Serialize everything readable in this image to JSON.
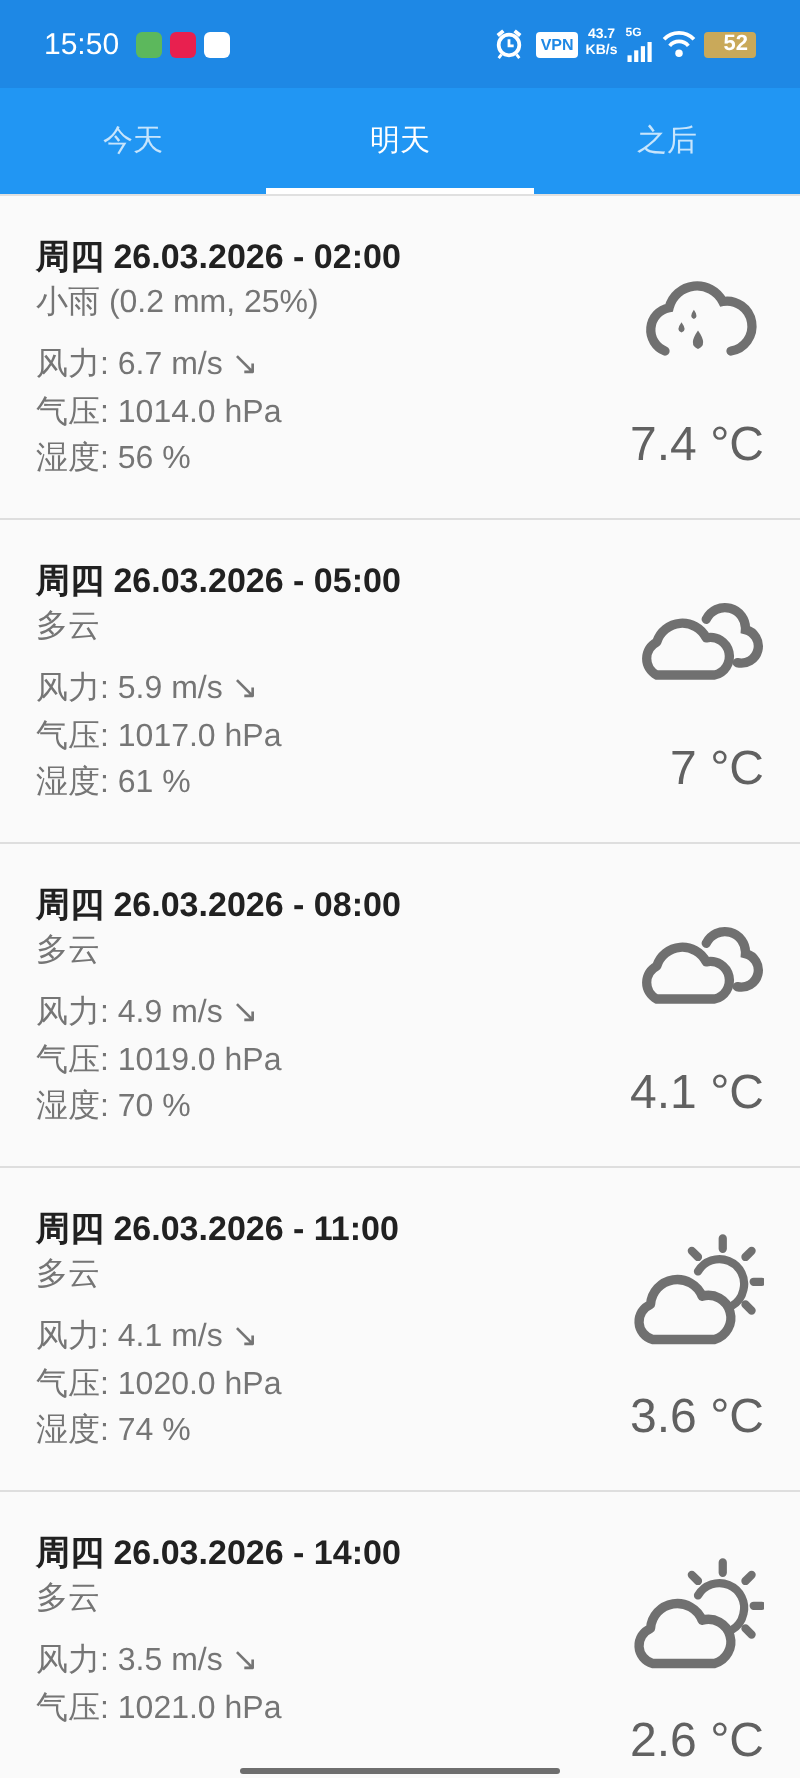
{
  "status_bar": {
    "time": "15:50",
    "apps": [
      {
        "color": "#5cb85c"
      },
      {
        "color": "#e8204f"
      },
      {
        "color": "#ffffff"
      }
    ],
    "vpn": "VPN",
    "speed_value": "43.7",
    "speed_unit": "KB/s",
    "network": "5G",
    "battery": "52"
  },
  "tabs": [
    {
      "label": "今天",
      "selected": false
    },
    {
      "label": "明天",
      "selected": true
    },
    {
      "label": "之后",
      "selected": false
    }
  ],
  "forecasts": [
    {
      "datetime": "周四 26.03.2026 - 02:00",
      "condition": "小雨 (0.2 mm, 25%)",
      "wind": "风力: 6.7 m/s ↘",
      "pressure": "气压: 1014.0 hPa",
      "humidity": "湿度: 56 %",
      "temperature": "7.4 °C",
      "kind": "rain"
    },
    {
      "datetime": "周四 26.03.2026 - 05:00",
      "condition": "多云",
      "wind": "风力: 5.9 m/s ↘",
      "pressure": "气压: 1017.0 hPa",
      "humidity": "湿度: 61 %",
      "temperature": "7 °C",
      "kind": "cloudy"
    },
    {
      "datetime": "周四 26.03.2026 - 08:00",
      "condition": "多云",
      "wind": "风力: 4.9 m/s ↘",
      "pressure": "气压: 1019.0 hPa",
      "humidity": "湿度: 70 %",
      "temperature": "4.1 °C",
      "kind": "cloudy"
    },
    {
      "datetime": "周四 26.03.2026 - 11:00",
      "condition": "多云",
      "wind": "风力: 4.1 m/s ↘",
      "pressure": "气压: 1020.0 hPa",
      "humidity": "湿度: 74 %",
      "temperature": "3.6 °C",
      "kind": "partly"
    },
    {
      "datetime": "周四 26.03.2026 - 14:00",
      "condition": "多云",
      "wind": "风力: 3.5 m/s ↘",
      "pressure": "气压: 1021.0 hPa",
      "temperature": "2.6 °C",
      "kind": "partly"
    }
  ]
}
